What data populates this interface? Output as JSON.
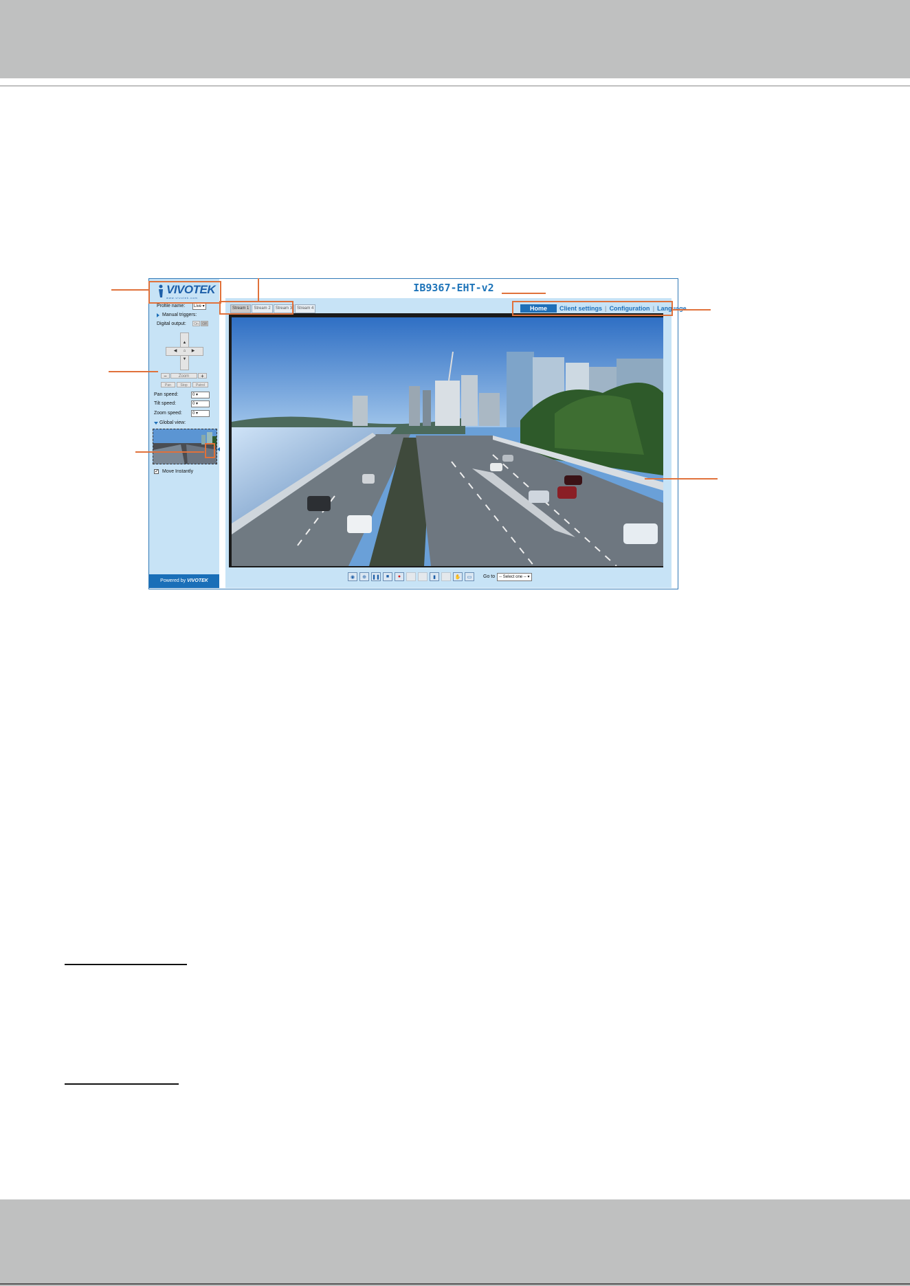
{
  "page_title": "IB9367-EHT-v2",
  "brand": {
    "logo_text": "VIVOTEK",
    "logo_tagline": "www.vivotek.com",
    "footer_prefix": "Powered by",
    "footer_brand": "VIVOTEK"
  },
  "stream_tabs": [
    "Stream 1",
    "Stream 2",
    "Stream 3",
    "Stream 4"
  ],
  "top_nav": {
    "home": "Home",
    "client_settings": "Client settings",
    "configuration": "Configuration",
    "language": "Language",
    "active": "Home"
  },
  "left_panel": {
    "profile_name_label": "Profile name:",
    "profile_name_value": "Live",
    "manual_triggers_label": "Manual triggers:",
    "digital_output_label": "Digital output:",
    "digital_output_on": "On",
    "digital_output_off": "Off",
    "zoom_label": "Zoom",
    "zoom_minus": "−",
    "zoom_plus": "+",
    "pan_btn": "Pan",
    "stop_btn": "Stop",
    "patrol_btn": "Patrol",
    "pan_speed_label": "Pan speed:",
    "pan_speed_value": "0",
    "tilt_speed_label": "Tilt speed:",
    "tilt_speed_value": "0",
    "zoom_speed_label": "Zoom speed:",
    "zoom_speed_value": "0",
    "global_view_label": "Global view:",
    "move_instantly_label": "Move Instantly",
    "move_instantly_checked": true
  },
  "toolbar": {
    "icons": [
      "snapshot-icon",
      "digital-zoom-icon",
      "pause-icon",
      "stop-icon",
      "record-icon",
      "volume-icon",
      "mute-icon",
      "talk-icon",
      "mic-mute-icon",
      "ptz-mode-icon",
      "fullscreen-icon"
    ],
    "goto_label": "Go to",
    "goto_value": "-- Select one --"
  },
  "colors": {
    "accent": "#1e6fb8",
    "panel_bg": "#c7e3f6",
    "callout": "#e0713a",
    "manual_band": "#bfc0c0"
  }
}
